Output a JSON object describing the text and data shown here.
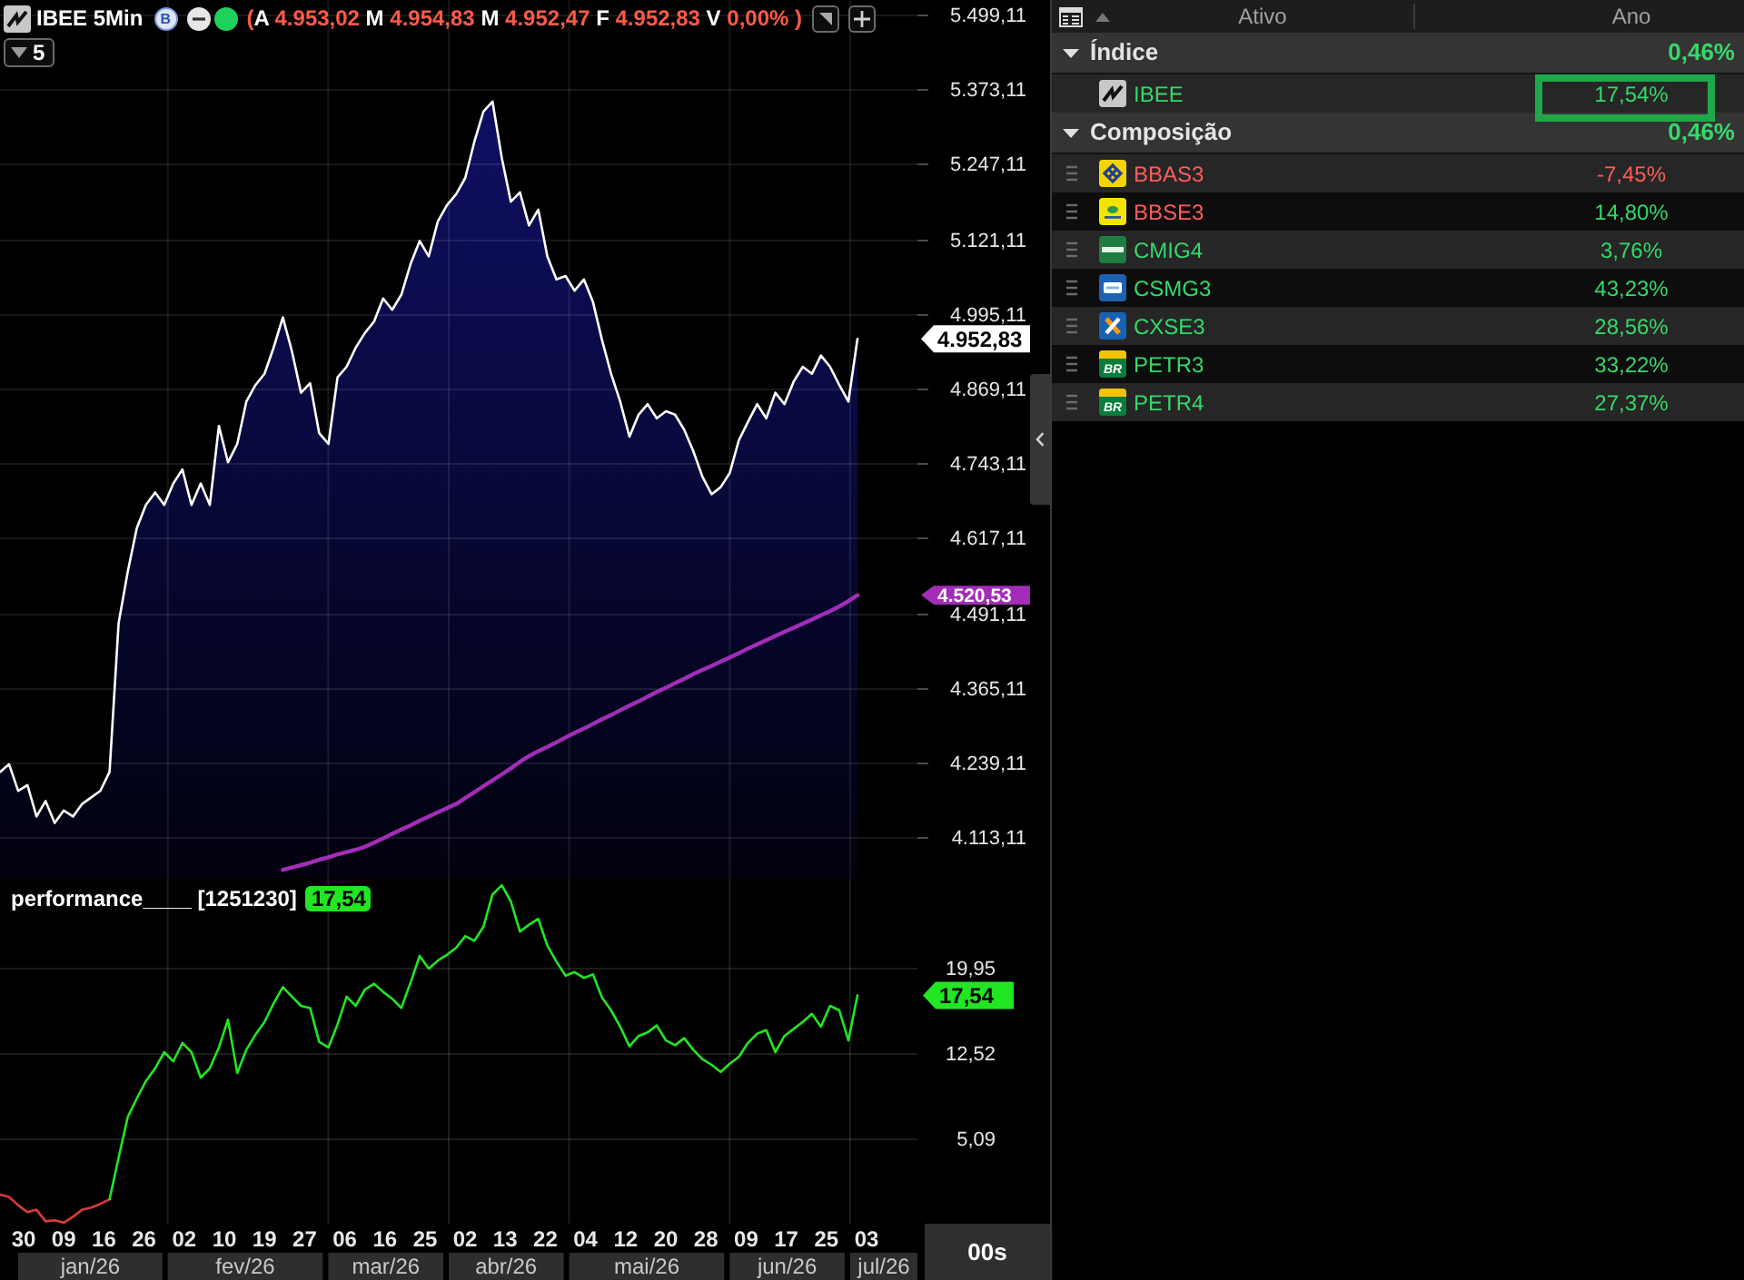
{
  "header": {
    "symbol": "IBEE 5Min",
    "mode_badge": "B",
    "live": true,
    "quote_open": "(",
    "quote": [
      {
        "label": "A",
        "value": "4.953,02"
      },
      {
        "label": "M",
        "value": "4.954,83"
      },
      {
        "label": "M",
        "value": "4.952,47"
      },
      {
        "label": "F",
        "value": "4.952,83"
      },
      {
        "label": "V",
        "value": "0,00%"
      }
    ],
    "quote_close": ")",
    "quote_declining": true,
    "period_button": "5"
  },
  "price_chart": {
    "chart_data": {
      "type": "area",
      "grid": true,
      "ylim": [
        4043,
        5524
      ],
      "yticks": [
        {
          "value": 5499.11,
          "label": "5.499,11"
        },
        {
          "value": 5373.11,
          "label": "5.373,11"
        },
        {
          "value": 5247.11,
          "label": "5.247,11"
        },
        {
          "value": 5121.11,
          "label": "5.121,11"
        },
        {
          "value": 4995.11,
          "label": "4.995,11"
        },
        {
          "value": 4869.11,
          "label": "4.869,11"
        },
        {
          "value": 4743.11,
          "label": "4.743,11"
        },
        {
          "value": 4617.11,
          "label": "4.617,11"
        },
        {
          "value": 4491.11,
          "label": "4.491,11"
        },
        {
          "value": 4365.11,
          "label": "4.365,11"
        },
        {
          "value": 4239.11,
          "label": "4.239,11"
        },
        {
          "value": 4113.11,
          "label": "4.113,11"
        }
      ],
      "series": [
        {
          "type": "area",
          "color": "#ffffff",
          "values": [
            4223,
            4236,
            4191,
            4201,
            4148,
            4174,
            4137,
            4158,
            4148,
            4169,
            4180,
            4191,
            4223,
            4474,
            4560,
            4634,
            4673,
            4694,
            4673,
            4709,
            4733,
            4673,
            4709,
            4673,
            4806,
            4745,
            4776,
            4847,
            4875,
            4894,
            4938,
            4989,
            4932,
            4862,
            4878,
            4794,
            4776,
            4888,
            4906,
            4938,
            4963,
            4982,
            5021,
            5002,
            5027,
            5079,
            5118,
            5092,
            5151,
            5178,
            5197,
            5224,
            5285,
            5336,
            5353,
            5258,
            5184,
            5200,
            5144,
            5171,
            5092,
            5053,
            5059,
            5034,
            5053,
            5015,
            4951,
            4894,
            4847,
            4788,
            4825,
            4843,
            4819,
            4831,
            4825,
            4800,
            4764,
            4721,
            4691,
            4703,
            4727,
            4782,
            4813,
            4843,
            4819,
            4862,
            4843,
            4881,
            4906,
            4894,
            4925,
            4906,
            4875,
            4847,
            4953
          ]
        },
        {
          "type": "line",
          "color": "#a32db9",
          "values": [
            null,
            null,
            null,
            null,
            null,
            null,
            null,
            null,
            null,
            null,
            null,
            null,
            null,
            null,
            null,
            null,
            null,
            null,
            null,
            null,
            null,
            null,
            null,
            null,
            null,
            null,
            null,
            null,
            null,
            null,
            null,
            4058,
            4062,
            4066,
            4070,
            4075,
            4079,
            4084,
            4088,
            4092,
            4097,
            4104,
            4111,
            4119,
            4126,
            4133,
            4141,
            4148,
            4155,
            4162,
            4169,
            4179,
            4189,
            4199,
            4209,
            4219,
            4229,
            4240,
            4250,
            4258,
            4265,
            4273,
            4281,
            4289,
            4296,
            4304,
            4312,
            4319,
            4327,
            4335,
            4342,
            4350,
            4358,
            4365,
            4373,
            4380,
            4388,
            4395,
            4402,
            4409,
            4416,
            4423,
            4431,
            4438,
            4445,
            4452,
            4459,
            4466,
            4473,
            4480,
            4487,
            4494,
            4502,
            4511,
            4521
          ]
        }
      ],
      "annotations": [
        "4.952,83",
        "4.520,53"
      ]
    }
  },
  "performance_chart": {
    "title_badge": "17,54",
    "chart_data": {
      "type": "line",
      "grid": true,
      "title": "performance____ [1251230]",
      "ylim": [
        -2.2,
        27.4
      ],
      "yticks": [
        {
          "value": 5.09,
          "label": "5,09"
        },
        {
          "value": 12.52,
          "label": "12,52"
        },
        {
          "value": 19.95,
          "label": "19,95"
        }
      ],
      "series": [
        {
          "color": "#d93b3b",
          "values": [
            0.3,
            0.1,
            -0.6,
            -1.2,
            -1.0,
            -2.0,
            -1.9,
            -2.1,
            -1.6,
            -1.0,
            -0.8,
            -0.5,
            -0.1,
            null,
            null,
            null,
            null,
            null,
            null,
            null,
            null,
            null,
            null,
            null,
            null,
            null,
            null,
            null,
            null,
            null,
            null,
            null,
            null,
            null,
            null,
            null,
            null,
            null,
            null,
            null,
            null,
            null,
            null,
            null,
            null,
            null,
            null,
            null,
            null,
            null,
            null,
            null,
            null,
            null,
            null,
            null,
            null,
            null,
            null,
            null,
            null,
            null,
            null,
            null,
            null,
            null,
            null,
            null,
            null,
            null,
            null,
            null,
            null,
            null,
            null,
            null,
            null,
            null,
            null,
            null,
            null,
            null,
            null,
            null,
            null,
            null,
            null,
            null,
            null,
            null,
            null,
            null,
            null,
            null,
            null
          ]
        },
        {
          "color": "#22e622",
          "values": [
            null,
            null,
            null,
            null,
            null,
            null,
            null,
            null,
            null,
            null,
            null,
            null,
            -0.1,
            3.5,
            7.0,
            8.6,
            10.1,
            11.2,
            12.6,
            11.8,
            13.4,
            12.6,
            10.4,
            11.2,
            13.0,
            15.4,
            10.8,
            12.8,
            14.1,
            15.2,
            16.8,
            18.2,
            17.4,
            16.6,
            16.4,
            13.5,
            13.0,
            15.0,
            17.4,
            16.6,
            18.0,
            18.5,
            17.8,
            17.2,
            16.4,
            18.6,
            20.9,
            19.8,
            20.5,
            21.0,
            21.6,
            22.6,
            22.2,
            23.4,
            26.2,
            27.0,
            25.6,
            23.0,
            23.6,
            24.1,
            21.8,
            20.4,
            19.2,
            19.5,
            19.0,
            19.3,
            17.3,
            16.2,
            14.8,
            13.1,
            14.0,
            14.3,
            14.9,
            13.6,
            13.2,
            13.8,
            12.8,
            12.0,
            11.5,
            10.9,
            11.6,
            12.2,
            13.4,
            14.2,
            14.5,
            12.6,
            14.0,
            14.6,
            15.2,
            15.9,
            14.8,
            16.6,
            16.2,
            13.6,
            17.5
          ]
        }
      ],
      "annotations": [
        "17,54"
      ]
    }
  },
  "time_axis": {
    "months": [
      {
        "label": "jan/26",
        "days": [
          "30",
          "09",
          "16",
          "26"
        ]
      },
      {
        "label": "fev/26",
        "days": [
          "02",
          "10",
          "19",
          "27"
        ]
      },
      {
        "label": "mar/26",
        "days": [
          "06",
          "16",
          "25"
        ]
      },
      {
        "label": "abr/26",
        "days": [
          "02",
          "13",
          "22"
        ]
      },
      {
        "label": "mai/26",
        "days": [
          "04",
          "12",
          "20",
          "28"
        ]
      },
      {
        "label": "jun/26",
        "days": [
          "09",
          "17",
          "25"
        ]
      },
      {
        "label": "jul/26",
        "days": [
          "03"
        ]
      }
    ],
    "zoom_button": "00s"
  },
  "asset_panel": {
    "columns": [
      {
        "label": "Ativo",
        "sorted": true
      },
      {
        "label": "Ano",
        "sorted": false
      }
    ],
    "groups": [
      {
        "label": "Índice",
        "value": "0,46%",
        "value_declining": false,
        "expanded": true,
        "rows": [
          {
            "symbol": "IBEE",
            "kind": "zigzag",
            "value": "17,54%",
            "name_declining": false,
            "value_declining": false,
            "draggable": false,
            "highlighted": true
          }
        ]
      },
      {
        "label": "Composição",
        "value": "0,46%",
        "value_declining": false,
        "expanded": true,
        "rows": [
          {
            "symbol": "BBAS3",
            "kind": "lattice",
            "value": "-7,45%",
            "name_declining": true,
            "value_declining": true,
            "draggable": true,
            "highlighted": false
          },
          {
            "symbol": "BBSE3",
            "kind": "emblem",
            "value": "14,80%",
            "name_declining": true,
            "value_declining": false,
            "draggable": true,
            "highlighted": false
          },
          {
            "symbol": "CMIG4",
            "kind": "wordmark",
            "value": "3,76%",
            "name_declining": false,
            "value_declining": false,
            "draggable": true,
            "highlighted": false
          },
          {
            "symbol": "CSMG3",
            "kind": "card",
            "value": "43,23%",
            "name_declining": false,
            "value_declining": false,
            "draggable": true,
            "highlighted": false
          },
          {
            "symbol": "CXSE3",
            "kind": "cross",
            "value": "28,56%",
            "name_declining": false,
            "value_declining": false,
            "draggable": true,
            "highlighted": false
          },
          {
            "symbol": "PETR3",
            "kind": "monogram",
            "logo_text": "BR",
            "value": "33,22%",
            "name_declining": false,
            "value_declining": false,
            "draggable": true,
            "highlighted": false
          },
          {
            "symbol": "PETR4",
            "kind": "monogram",
            "logo_text": "BR",
            "value": "27,37%",
            "name_declining": false,
            "value_declining": false,
            "draggable": true,
            "highlighted": false
          }
        ]
      }
    ]
  }
}
